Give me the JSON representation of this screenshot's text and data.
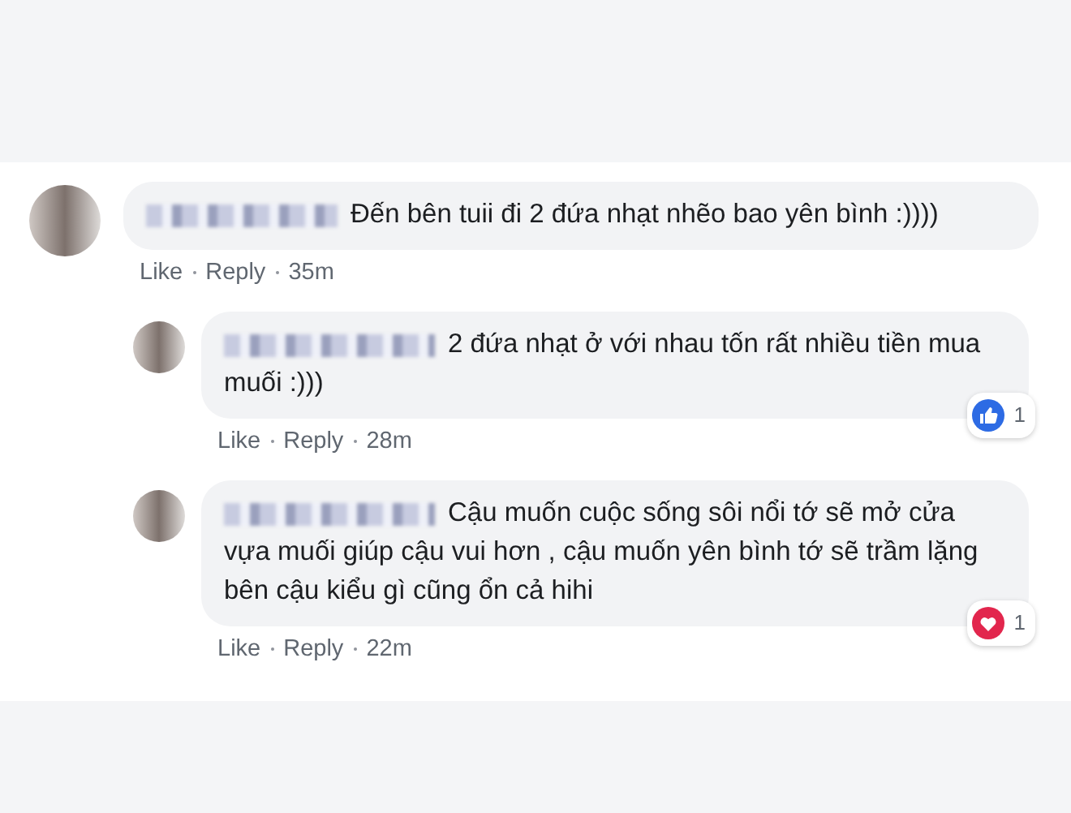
{
  "comments": [
    {
      "text": "Đến bên tuii đi 2 đứa nhạt nhẽo bao yên bình :))))",
      "actions": [
        "Like",
        "Reply",
        "35m"
      ],
      "replies": [
        {
          "text": "2 đứa nhạt ở với nhau tốn rất nhiều tiền mua muối :)))",
          "actions": [
            "Like",
            "Reply",
            "28m"
          ],
          "reaction": {
            "kind": "like",
            "count": "1"
          }
        },
        {
          "text": "Cậu muốn cuộc sống sôi nổi tớ sẽ mở cửa vựa muối giúp cậu vui hơn , cậu muốn yên bình tớ sẽ trầm lặng bên cậu kiểu gì cũng ổn cả hihi",
          "actions": [
            "Like",
            "Reply",
            "22m"
          ],
          "reaction": {
            "kind": "love",
            "count": "1"
          }
        }
      ]
    }
  ]
}
